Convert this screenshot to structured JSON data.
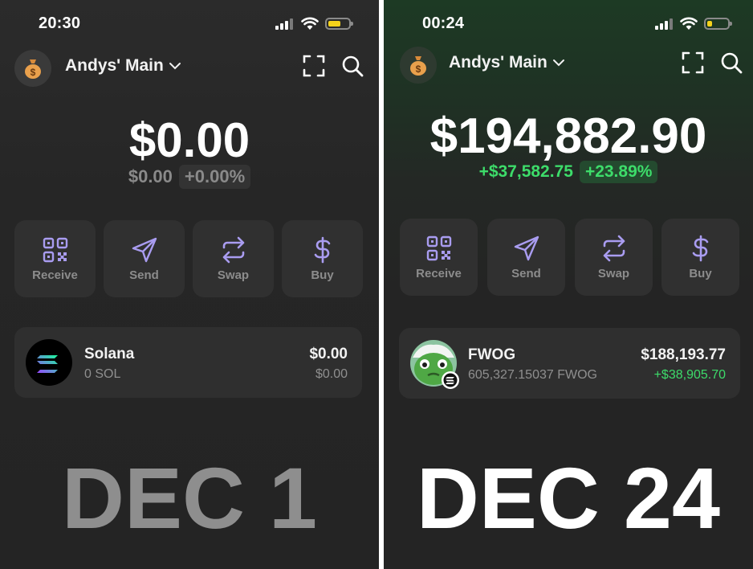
{
  "colors": {
    "green": "#3ddc6a",
    "icon_purple": "#a99cf0",
    "label_gray": "#8c8c8c",
    "left_date": "#8e8e8e",
    "right_date": "#ffffff"
  },
  "left": {
    "status": {
      "time": "20:30",
      "battery_level": 0.55
    },
    "account": {
      "name": "Andys' Main",
      "avatar_icon": "money-bag-icon"
    },
    "balance": "$0.00",
    "change_amount": "$0.00",
    "change_percent": "+0.00%",
    "actions": [
      {
        "label": "Receive",
        "icon": "qr-code-icon"
      },
      {
        "label": "Send",
        "icon": "send-icon"
      },
      {
        "label": "Swap",
        "icon": "swap-icon"
      },
      {
        "label": "Buy",
        "icon": "dollar-icon"
      }
    ],
    "token": {
      "name": "Solana",
      "amount": "0 SOL",
      "value": "$0.00",
      "change": "$0.00",
      "icon": "solana-logo-icon"
    },
    "date_label": "DEC 1"
  },
  "right": {
    "status": {
      "time": "00:24",
      "battery_level": 0.2
    },
    "account": {
      "name": "Andys' Main",
      "avatar_icon": "money-bag-icon"
    },
    "balance": "$194,882.90",
    "change_amount": "+$37,582.75",
    "change_percent": "+23.89%",
    "actions": [
      {
        "label": "Receive",
        "icon": "qr-code-icon"
      },
      {
        "label": "Send",
        "icon": "send-icon"
      },
      {
        "label": "Swap",
        "icon": "swap-icon"
      },
      {
        "label": "Buy",
        "icon": "dollar-icon"
      }
    ],
    "token": {
      "name": "FWOG",
      "amount": "605,327.15037 FWOG",
      "value": "$188,193.77",
      "change": "+$38,905.70",
      "icon": "fwog-frog-icon"
    },
    "date_label": "DEC 24"
  }
}
